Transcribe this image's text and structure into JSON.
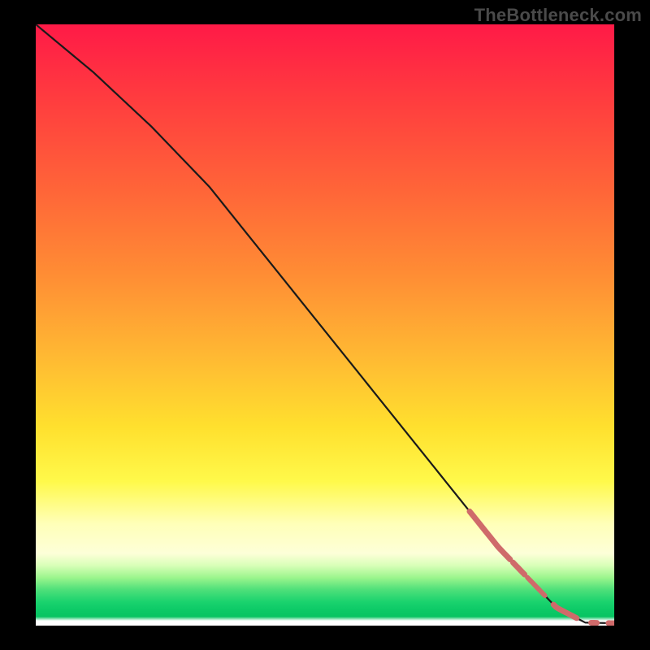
{
  "watermark": "TheBottleneck.com",
  "colors": {
    "line": "#1a1a1a",
    "marker": "#cf6a6a",
    "marker_stroke": "#b45a5a",
    "background": "#000000"
  },
  "chart_data": {
    "type": "line",
    "title": "",
    "xlabel": "",
    "ylabel": "",
    "xlim": [
      0,
      100
    ],
    "ylim": [
      0,
      100
    ],
    "grid": false,
    "series": [
      {
        "name": "curve",
        "x": [
          0,
          10,
          20,
          30,
          40,
          50,
          60,
          70,
          80,
          90,
          95,
          100
        ],
        "y": [
          100,
          92,
          83,
          73,
          61,
          49,
          37,
          25,
          13,
          3,
          0.5,
          0.4
        ]
      }
    ],
    "markers": [
      {
        "x1": 75,
        "x2": 82,
        "thick": 7
      },
      {
        "x1": 82.5,
        "x2": 84.5,
        "thick": 7
      },
      {
        "x1": 85,
        "x2": 88,
        "thick": 6
      },
      {
        "x1": 89.5,
        "x2": 93.5,
        "thick": 7
      },
      {
        "x1": 96,
        "x2": 97,
        "thick": 7
      },
      {
        "x1": 99,
        "x2": 100,
        "thick": 7
      }
    ],
    "annotations": []
  }
}
